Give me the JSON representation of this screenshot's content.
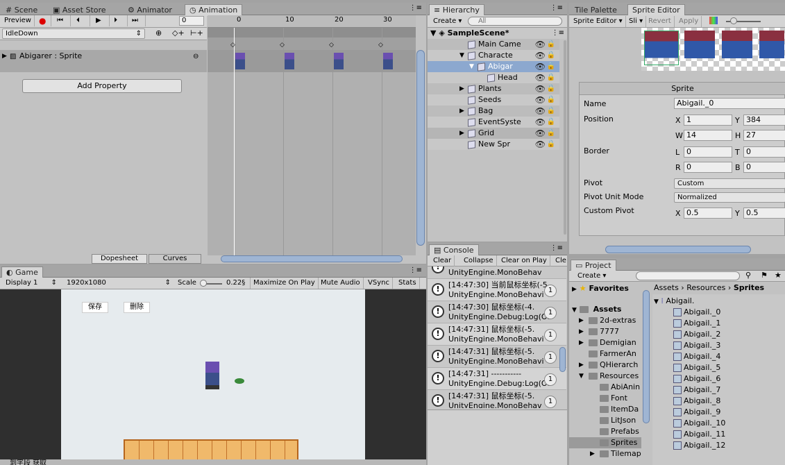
{
  "anim_tabs": [
    "Scene",
    "Asset Store",
    "Animator",
    "Animation"
  ],
  "hier_tab": "Hierarchy",
  "sprite_tabs": [
    "Tile Palette",
    "Sprite Editor"
  ],
  "anim": {
    "preview": "Preview",
    "frame": "0",
    "clip": "IdleDown",
    "ruler": [
      "0",
      "10",
      "20",
      "30"
    ],
    "track": "Abigarer : Sprite",
    "add_property": "Add Property",
    "dopesheet": "Dopesheet",
    "curves": "Curves"
  },
  "hierarchy": {
    "create": "Create ▾",
    "search_placeholder": "All",
    "scene": "SampleScene*",
    "items": [
      "Main Came",
      "Characte",
      "Abigar",
      "Head",
      "Plants",
      "Seeds",
      "Bag",
      "EventSyste",
      "Grid",
      "New Spr"
    ]
  },
  "sprite_editor": {
    "toolbar": [
      "Sprite Editor ▾",
      "Sli ▾",
      "Revert",
      "Apply"
    ],
    "box_title": "Sprite",
    "name_label": "Name",
    "name_value": "Abigail._0",
    "position_label": "Position",
    "x": "1",
    "y": "384",
    "w": "14",
    "h": "27",
    "border_label": "Border",
    "l": "0",
    "t": "0",
    "r": "0",
    "b": "0",
    "pivot_label": "Pivot",
    "pivot_value": "Custom",
    "pivot_unit_label": "Pivot Unit Mode",
    "pivot_unit_value": "Normalized",
    "custom_pivot_label": "Custom Pivot",
    "px": "0.5",
    "py": "0.5",
    "axes": [
      "X",
      "Y",
      "W",
      "H",
      "L",
      "T",
      "R",
      "B",
      "X",
      "Y"
    ]
  },
  "game": {
    "tab": "Game",
    "display": "Display 1",
    "resolution": "1920x1080",
    "scale_label": "Scale",
    "scale_value": "0.22§",
    "toolbar": [
      "Maximize On Play",
      "Mute Audio",
      "VSync",
      "Stats"
    ],
    "btn_save": "保存",
    "btn_delete": "删除"
  },
  "console": {
    "tab": "Console",
    "toolbar": [
      "Clear",
      "Collapse",
      "Clear on Play",
      "Cle"
    ],
    "rows": [
      {
        "l1": "",
        "l2": "UnityEngine.MonoBehav",
        "count": ""
      },
      {
        "l1": "[14:47:30] 当前鼠标坐标(-5",
        "l2": "UnityEngine.MonoBehavi",
        "count": "1"
      },
      {
        "l1": "[14:47:30] 鼠标坐标(-4.",
        "l2": "UnityEngine.Debug:Log(Ob",
        "count": "1"
      },
      {
        "l1": "[14:47:31] 鼠标坐标(-5.",
        "l2": "UnityEngine.MonoBehavi",
        "count": "1"
      },
      {
        "l1": "[14:47:31] 鼠标坐标(-5.",
        "l2": "UnityEngine.MonoBehavi",
        "count": "1"
      },
      {
        "l1": "[14:47:31] -----------",
        "l2": "UnityEngine.Debug:Log(Ob",
        "count": "1"
      },
      {
        "l1": "[14:47:31] 鼠标坐标(-5.",
        "l2": "UnityEngine.MonoBehav",
        "count": "1"
      }
    ]
  },
  "project": {
    "tab": "Project",
    "create": "Create ▾",
    "favorites": "Favorites",
    "assets": "Assets",
    "breadcrumb": [
      "Assets",
      "Resources",
      "Sprites"
    ],
    "folders": [
      "2d-extras",
      "7777",
      "Demigian",
      "FarmerAn",
      "QHierarch",
      "Resources",
      "AbiAnin",
      "Font",
      "ItemDa",
      "LitJson",
      "Prefabs",
      "Sprites",
      "Tilemap"
    ],
    "sheet": "Abigail.",
    "sprites": [
      "Abigail._0",
      "Abigail._1",
      "Abigail._2",
      "Abigail._3",
      "Abigail._4",
      "Abigail._5",
      "Abigail._6",
      "Abigail._7",
      "Abigail._8",
      "Abigail._9",
      "Abigail._10",
      "Abigail._11",
      "Abigail._12"
    ]
  },
  "status": "到字段 获取 "
}
